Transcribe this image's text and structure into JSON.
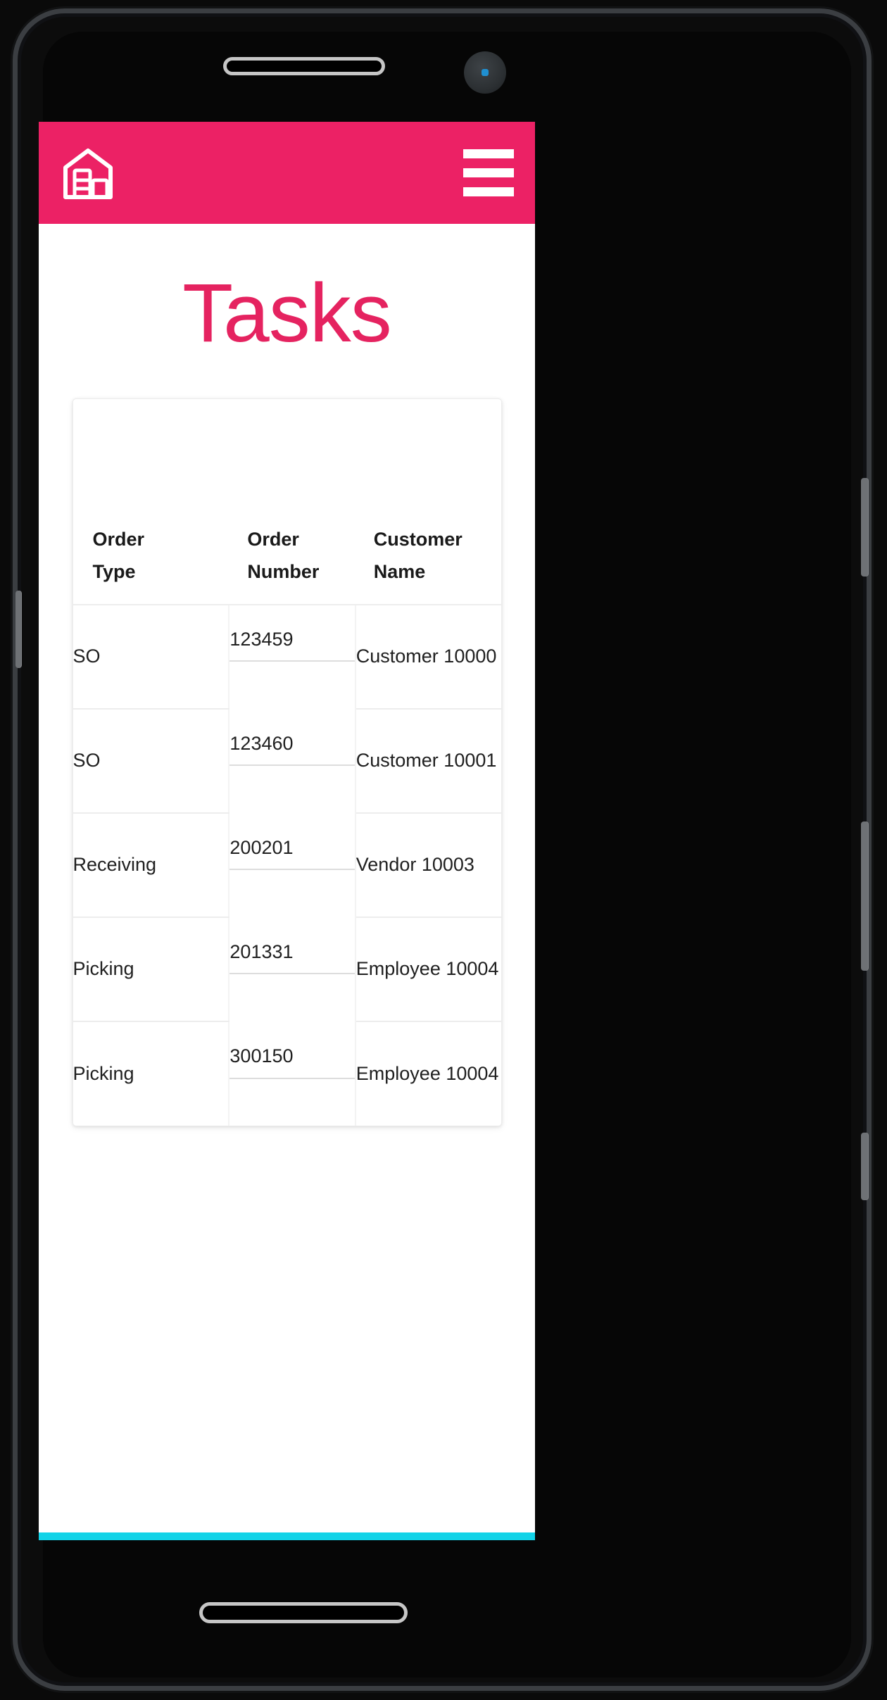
{
  "device": {
    "speaker_name": "earpiece-speaker",
    "camera_name": "front-camera",
    "home_bar_name": "home-indicator"
  },
  "app": {
    "header": {
      "logo_label": "warehouse-logo",
      "menu_label": "Menu",
      "background_color": "#EC2165"
    },
    "page_title": "Tasks",
    "accent_color": "#E52360",
    "bottom_bar_color": "#12D3E8"
  },
  "table": {
    "columns": [
      {
        "id": "order_type",
        "label_line1": "Order",
        "label_line2": "Type"
      },
      {
        "id": "order_number",
        "label_line1": "Order",
        "label_line2": "Number"
      },
      {
        "id": "customer_name",
        "label_line1": "Customer",
        "label_line2": "Name"
      }
    ],
    "rows": [
      {
        "order_type": "SO",
        "order_number": "123459",
        "customer_name": "Customer 10000"
      },
      {
        "order_type": "SO",
        "order_number": "123460",
        "customer_name": "Customer 10001"
      },
      {
        "order_type": "Receiving",
        "order_number": "200201",
        "customer_name": "Vendor 10003"
      },
      {
        "order_type": "Picking",
        "order_number": "201331",
        "customer_name": "Employee 10004"
      },
      {
        "order_type": "Picking",
        "order_number": "300150",
        "customer_name": "Employee 10004"
      }
    ]
  }
}
